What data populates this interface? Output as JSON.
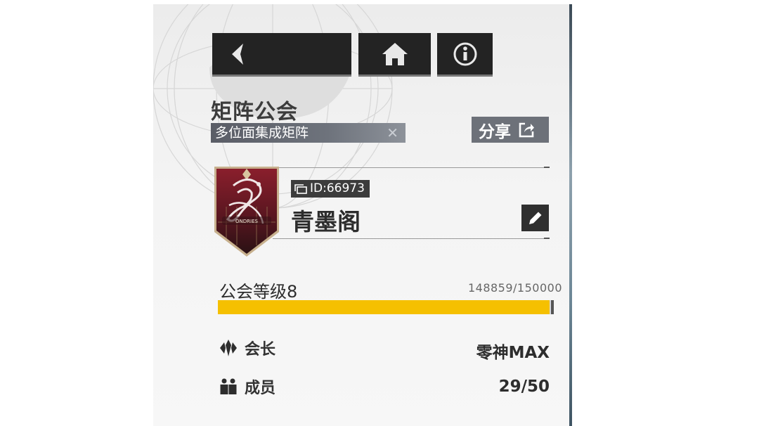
{
  "nav": {
    "back_icon": "chevron-left-icon",
    "home_icon": "home-icon",
    "info_icon": "info-icon"
  },
  "guild": {
    "type_title": "矩阵公会",
    "tag": "多位面集成矩阵",
    "tag_close": "✕",
    "share_label": "分享",
    "share_icon": "share-icon",
    "emblem_text": "ONDRIES",
    "id_label": "ID:66973",
    "name": "青墨阁",
    "edit_icon": "pencil-icon"
  },
  "level": {
    "label": "公会等级8",
    "exp_text": "148859/150000",
    "progress": 0.9924,
    "fill_color": "#f5c000"
  },
  "info": {
    "leader_label": "会长",
    "leader_value": "零神MAX",
    "members_label": "成员",
    "members_value": "29/50"
  }
}
